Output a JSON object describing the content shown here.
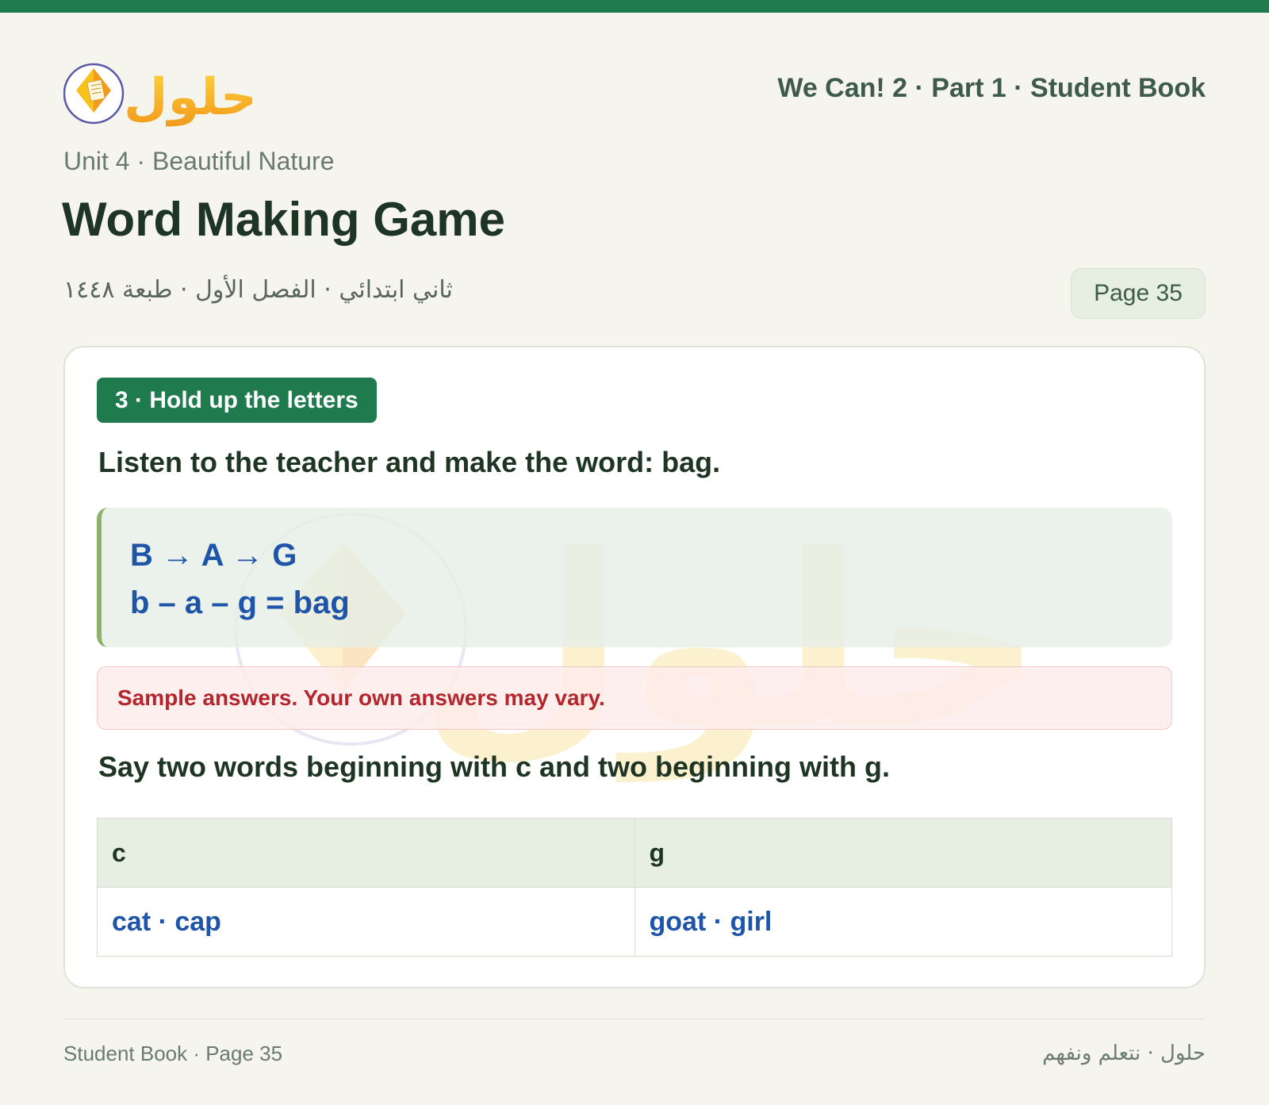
{
  "header": {
    "logo_text": "حلول",
    "book_title": "We Can! 2 · Part 1 · Student Book"
  },
  "page_heading": {
    "unit": "Unit 4 · Beautiful Nature",
    "title": "Word Making Game",
    "arabic_info": "ثاني ابتدائي · الفصل الأول · طبعة ١٤٤٨",
    "page_label": "Page 35"
  },
  "exercise": {
    "badge": "3 · Hold up the letters",
    "instruction": "Listen to the teacher and make the word: bag.",
    "answer_lines": [
      "B → A → G",
      "b – a – g = bag"
    ],
    "note": "Sample answers. Your own answers may vary.",
    "instruction2": "Say two words beginning with c and two beginning with g.",
    "table": {
      "headers": [
        "c",
        "g"
      ],
      "rows": [
        [
          "cat · cap",
          "goat · girl"
        ]
      ]
    }
  },
  "footer": {
    "left": "Student Book · Page 35",
    "right": "حلول · نتعلم ونفهم"
  },
  "colors": {
    "brand_green": "#1f7a4d",
    "answer_blue": "#1f55a8",
    "note_red": "#b3262d",
    "background": "#f5f5ee"
  }
}
